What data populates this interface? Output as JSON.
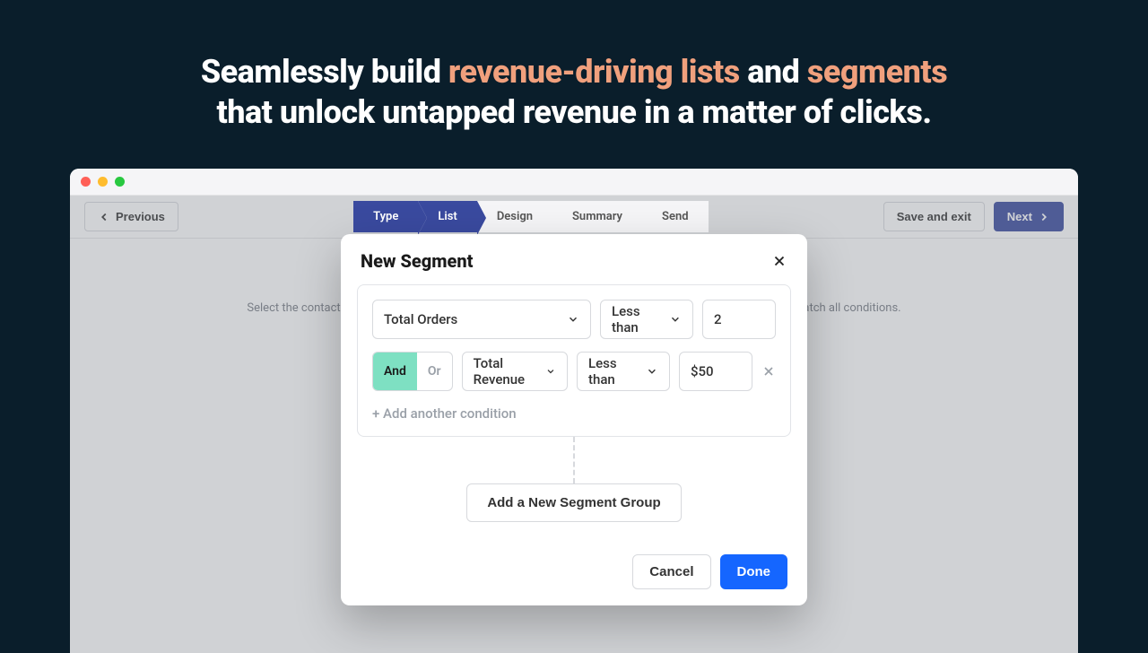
{
  "hero": {
    "pre1": "Seamlessly build ",
    "accent1": "revenue-driving lists",
    "mid": " and ",
    "accent2": "segments",
    "line2": "that unlock untapped revenue in a matter of clicks."
  },
  "topbar": {
    "previous": "Previous",
    "save_exit": "Save and exit",
    "next": "Next"
  },
  "steps": {
    "type": "Type",
    "list": "List",
    "design": "Design",
    "summary": "Summary",
    "send": "Send"
  },
  "bg_instruction": "Select the contacts you would like to include in this campaign. The campaign will be sent to contacts that match all conditions.",
  "modal": {
    "title": "New Segment",
    "row1": {
      "field": "Total Orders",
      "op": "Less than",
      "value": "2"
    },
    "row2": {
      "and": "And",
      "or": "Or",
      "field": "Total Revenue",
      "op": "Less than",
      "value": "$50"
    },
    "add_condition": "+ Add another condition",
    "add_group": "Add a New Segment Group",
    "cancel": "Cancel",
    "done": "Done"
  }
}
